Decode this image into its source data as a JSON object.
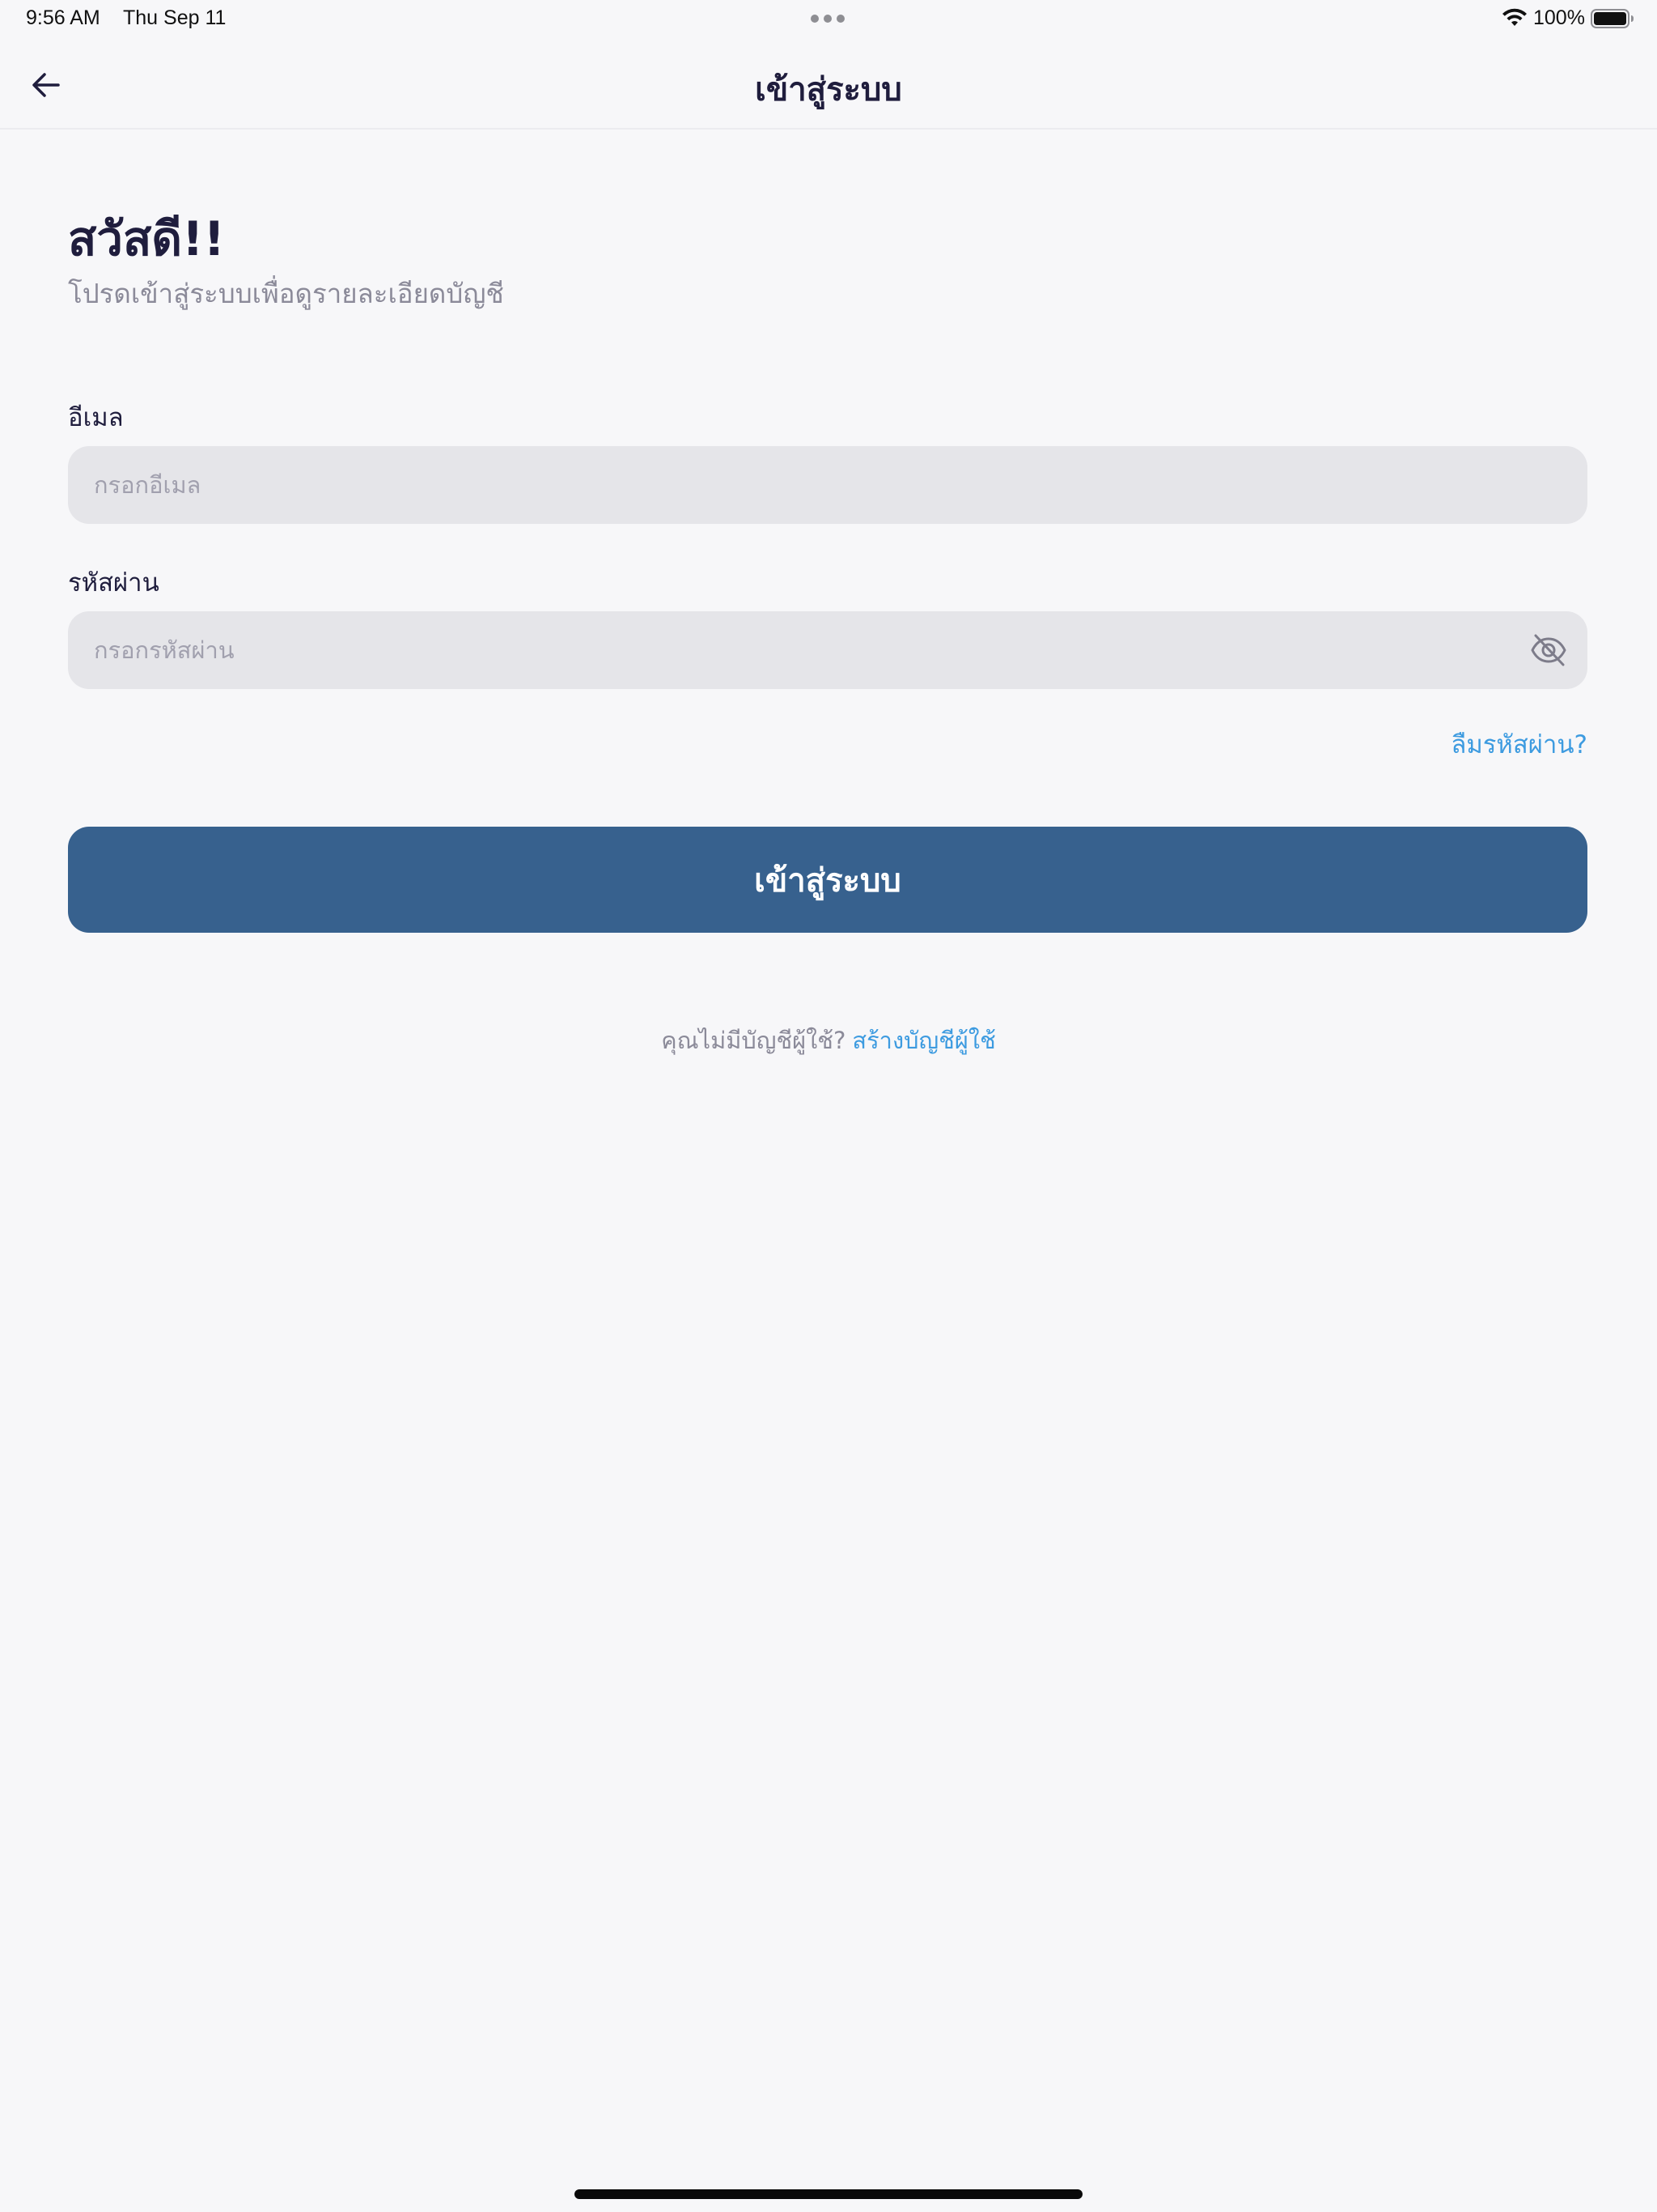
{
  "status_bar": {
    "time": "9:56 AM",
    "date": "Thu Sep 11",
    "battery_percent": "100%",
    "battery_level": 1.0
  },
  "nav": {
    "title": "เข้าสู่ระบบ",
    "back_icon": "arrow-left-icon"
  },
  "greeting": {
    "title": "สวัสดี!!",
    "subtitle": "โปรดเข้าสู่ระบบเพื่อดูรายละเอียดบัญชี"
  },
  "form": {
    "email_label": "อีเมล",
    "email_placeholder": "กรอกอีเมล",
    "email_value": "",
    "password_label": "รหัสผ่าน",
    "password_placeholder": "กรอกรหัสผ่าน",
    "password_value": "",
    "password_visibility_icon": "eye-slash-icon",
    "forgot_password": "ลืมรหัสผ่าน?",
    "submit_label": "เข้าสู่ระบบ"
  },
  "signup": {
    "prompt": "คุณไม่มีบัญชีผู้ใช้?",
    "link": "สร้างบัญชีผู้ใช้"
  },
  "colors": {
    "primary_button": "#37618e",
    "link": "#3d9be0",
    "heading": "#1f1d3d",
    "muted_text": "#8b8a99",
    "input_background": "#e5e5e9",
    "page_background": "#f7f7f9"
  }
}
